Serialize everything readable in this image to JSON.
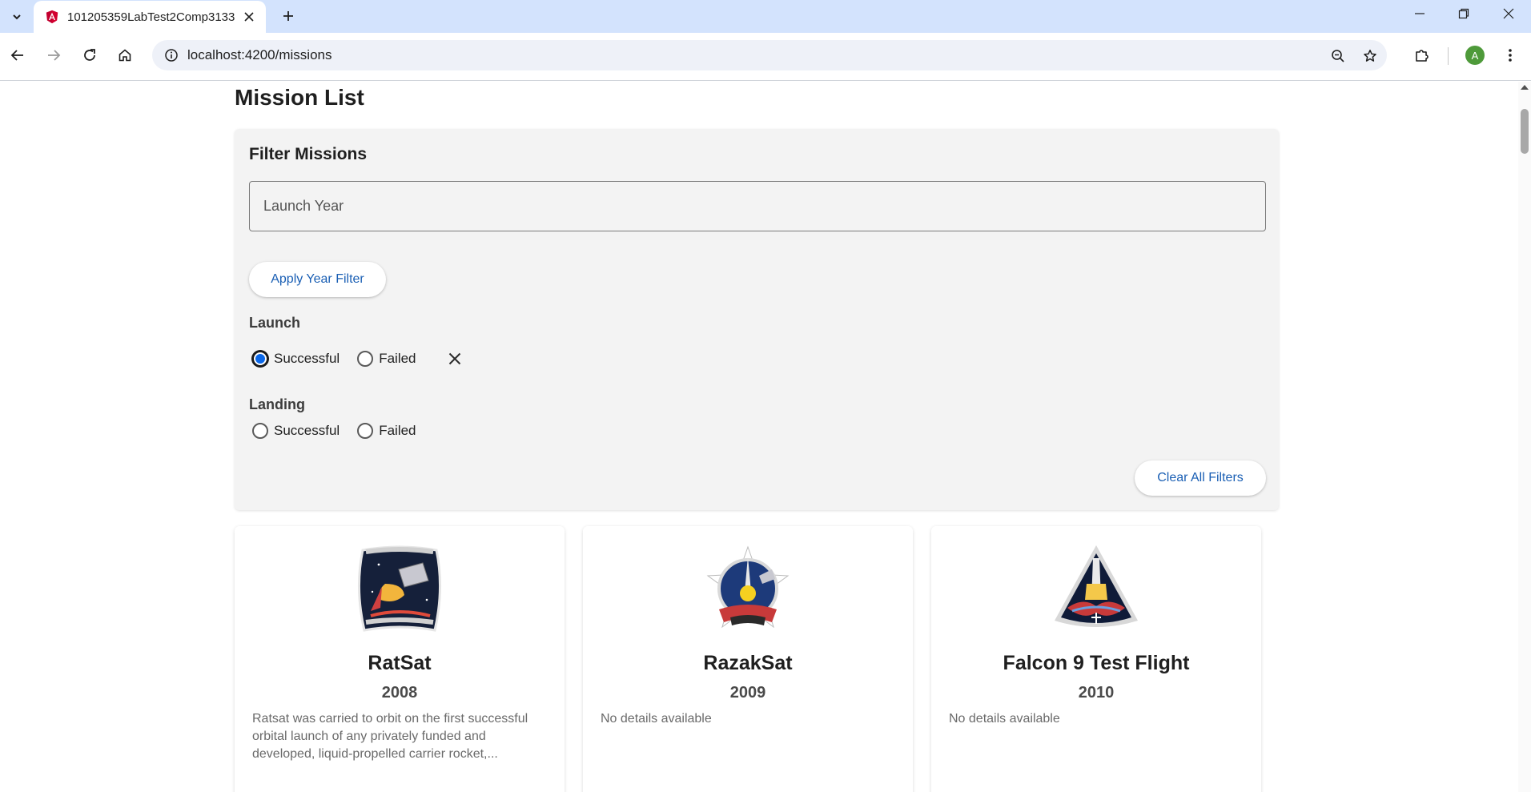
{
  "browser": {
    "tab_title": "101205359LabTest2Comp3133",
    "url": "localhost:4200/missions",
    "profile_initial": "A"
  },
  "colors": {
    "accent": "#1a5fb4",
    "radio_selected": "#0a67e8",
    "tabstrip": "#d3e3fd",
    "filter_panel": "#f3f3f3"
  },
  "icons": {
    "tab_search": "chevron-down-icon",
    "favicon": "angular-logo-icon",
    "tab_close": "close-icon",
    "new_tab": "plus-icon",
    "back": "arrow-left-icon",
    "forward": "arrow-right-icon",
    "reload": "reload-icon",
    "home": "home-icon",
    "site_info": "info-icon",
    "zoom": "zoom-icon",
    "bookmark": "star-icon",
    "extensions": "puzzle-icon",
    "menu": "kebab-menu-icon",
    "clear_launch": "close-icon"
  },
  "page": {
    "title": "Mission List"
  },
  "filters": {
    "title": "Filter Missions",
    "year_placeholder": "Launch Year",
    "year_value": "",
    "apply_label": "Apply Year Filter",
    "launch": {
      "label": "Launch",
      "options": [
        "Successful",
        "Failed"
      ],
      "selected": "Successful"
    },
    "landing": {
      "label": "Landing",
      "options": [
        "Successful",
        "Failed"
      ],
      "selected": null
    },
    "clear_label": "Clear All Filters"
  },
  "missions": [
    {
      "name": "RatSat",
      "year": "2008",
      "details": "Ratsat was carried to orbit on the first successful orbital launch of any privately funded and developed, liquid-propelled carrier rocket,...",
      "patch_icon": "mission-patch-ratsat-icon"
    },
    {
      "name": "RazakSat",
      "year": "2009",
      "details": "No details available",
      "patch_icon": "mission-patch-razaksat-icon"
    },
    {
      "name": "Falcon 9 Test Flight",
      "year": "2010",
      "details": "No details available",
      "patch_icon": "mission-patch-falcon9-icon"
    }
  ]
}
